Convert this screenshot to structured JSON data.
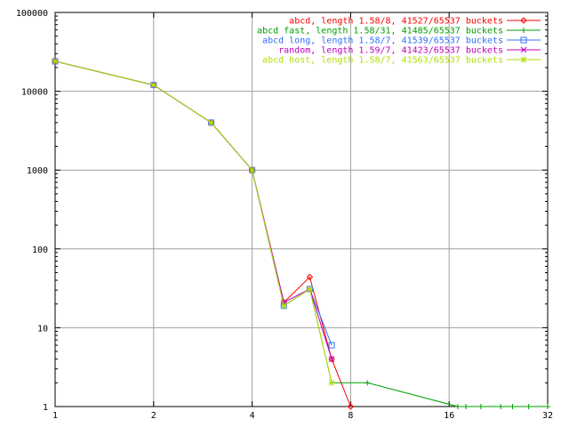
{
  "chart_data": {
    "type": "line",
    "title": "",
    "xlabel": "",
    "ylabel": "",
    "x_scale": "log2",
    "y_scale": "log10",
    "xlim": [
      1,
      32
    ],
    "ylim": [
      1,
      100000
    ],
    "grid": true,
    "legend_position": "top-right",
    "x_ticks": [
      {
        "value": 1,
        "label": "1"
      },
      {
        "value": 2,
        "label": "2"
      },
      {
        "value": 4,
        "label": "4"
      },
      {
        "value": 8,
        "label": "8"
      },
      {
        "value": 16,
        "label": "16"
      },
      {
        "value": 32,
        "label": "32"
      }
    ],
    "y_ticks": [
      {
        "value": 1,
        "label": "1"
      },
      {
        "value": 10,
        "label": "10"
      },
      {
        "value": 100,
        "label": "100"
      },
      {
        "value": 1000,
        "label": "1000"
      },
      {
        "value": 10000,
        "label": "10000"
      },
      {
        "value": 100000,
        "label": "100000"
      }
    ],
    "series": [
      {
        "name": "abcd, length 1.58/8, 41527/65537 buckets",
        "color": "#ff0000",
        "marker": "diamond",
        "points": [
          [
            1,
            24000
          ],
          [
            2,
            12000
          ],
          [
            3,
            4000
          ],
          [
            4,
            1000
          ],
          [
            5,
            21
          ],
          [
            6,
            44
          ],
          [
            7,
            4
          ],
          [
            8,
            1
          ]
        ]
      },
      {
        "name": "abcd fast, length 1.58/31, 41485/65537 buckets",
        "color": "#00a000",
        "marker": "plus",
        "points": [
          [
            1,
            24000
          ],
          [
            2,
            12000
          ],
          [
            3,
            4000
          ],
          [
            4,
            1000
          ],
          [
            5,
            19
          ],
          [
            6,
            31
          ],
          [
            7,
            2
          ],
          [
            9,
            2
          ],
          [
            17,
            1
          ],
          [
            18,
            1
          ],
          [
            20,
            1
          ],
          [
            23,
            1
          ],
          [
            25,
            1
          ],
          [
            28,
            1
          ],
          [
            32,
            1
          ]
        ]
      },
      {
        "name": "abcd long, length 1.58/7, 41539/65537 buckets",
        "color": "#3070ff",
        "marker": "square",
        "points": [
          [
            1,
            24000
          ],
          [
            2,
            12000
          ],
          [
            3,
            4000
          ],
          [
            4,
            1000
          ],
          [
            5,
            19
          ],
          [
            6,
            31
          ],
          [
            7,
            6
          ]
        ]
      },
      {
        "name": "random, length 1.59/7, 41423/65537 buckets",
        "color": "#c000c0",
        "marker": "cross",
        "points": [
          [
            1,
            24000
          ],
          [
            2,
            12000
          ],
          [
            3,
            4000
          ],
          [
            4,
            1000
          ],
          [
            5,
            21
          ],
          [
            6,
            31
          ],
          [
            7,
            4
          ]
        ]
      },
      {
        "name": "abcd host, length 1.58/7, 41563/65537 buckets",
        "color": "#b0e000",
        "marker": "star",
        "points": [
          [
            1,
            24000
          ],
          [
            2,
            12000
          ],
          [
            3,
            4000
          ],
          [
            4,
            1000
          ],
          [
            5,
            19
          ],
          [
            6,
            31
          ],
          [
            7,
            2
          ]
        ]
      }
    ]
  }
}
